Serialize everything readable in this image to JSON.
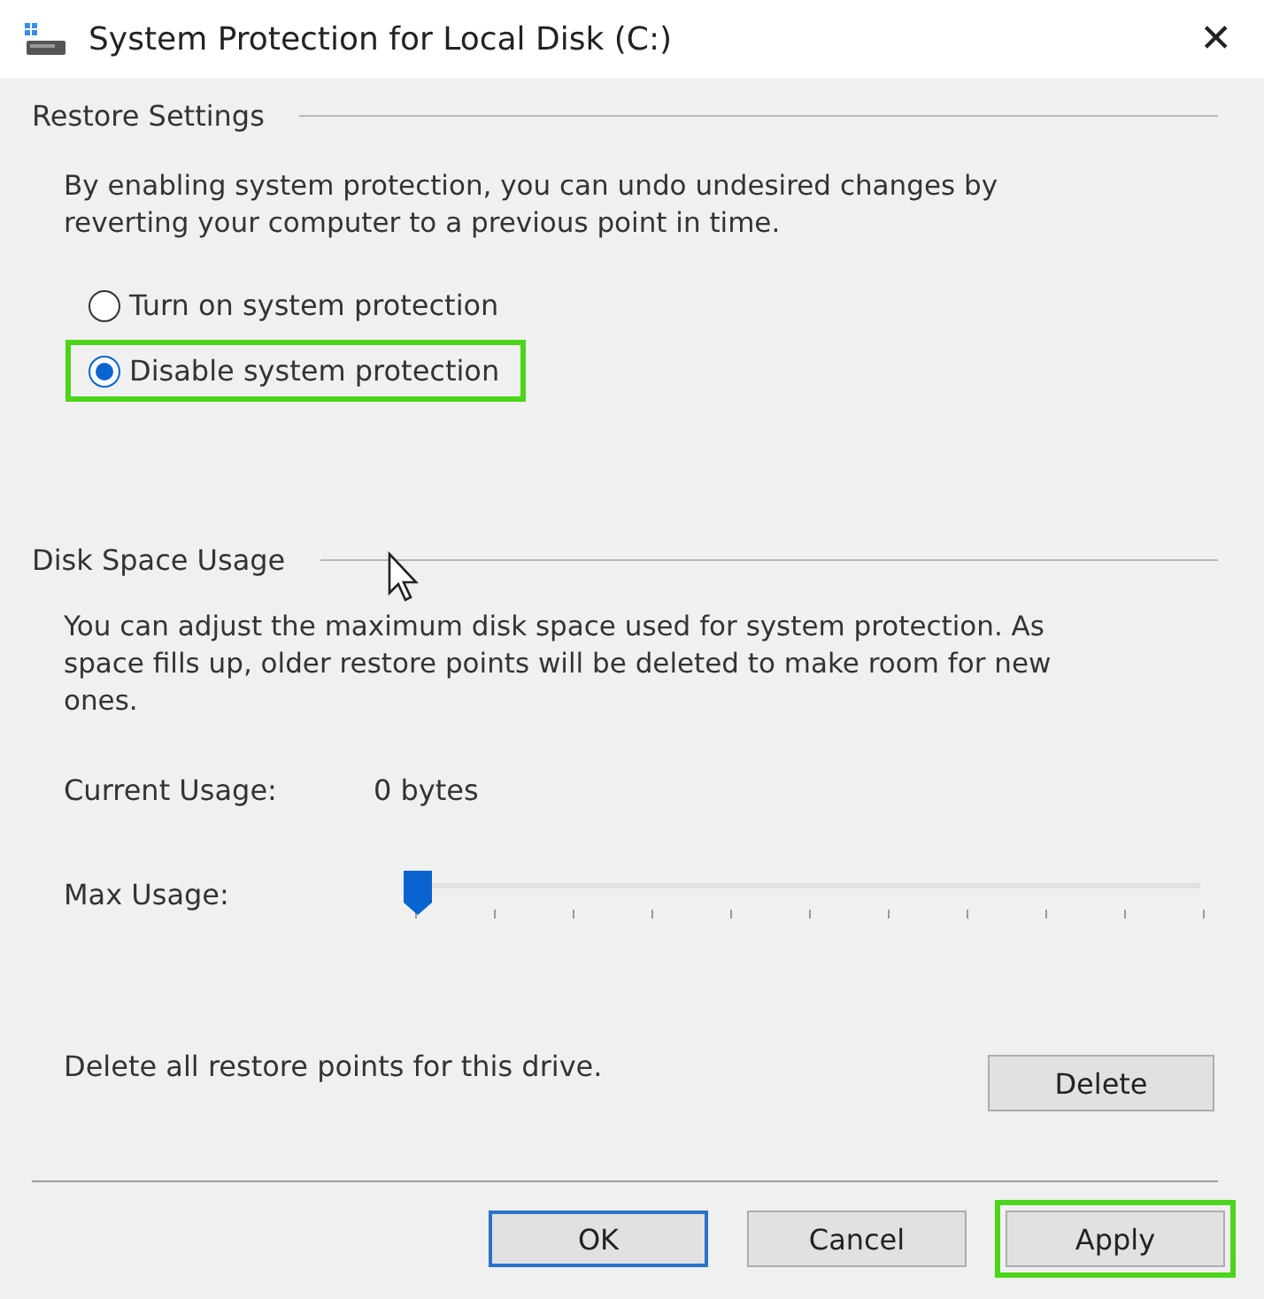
{
  "window": {
    "title": "System Protection for Local Disk (C:)",
    "close": "✕"
  },
  "restore_settings": {
    "heading": "Restore Settings",
    "description": "By enabling system protection, you can undo undesired changes by reverting your computer to a previous point in time.",
    "options": [
      {
        "label": "Turn on system protection",
        "selected": false,
        "highlighted": false
      },
      {
        "label": "Disable system protection",
        "selected": true,
        "highlighted": true
      }
    ]
  },
  "disk_space_usage": {
    "heading": "Disk Space Usage",
    "description": "You can adjust the maximum disk space used for system protection. As space fills up, older restore points will be deleted to make room for new ones.",
    "current_usage_label": "Current Usage:",
    "current_usage_value": "0 bytes",
    "max_usage_label": "Max Usage:",
    "max_usage": {
      "level": 0
    },
    "delete_label": "Delete all restore points for this drive.",
    "delete_button": "Delete"
  },
  "buttons": [
    {
      "label": "OK",
      "default": true,
      "highlighted": false
    },
    {
      "label": "Cancel",
      "default": false,
      "highlighted": false
    },
    {
      "label": "Apply",
      "default": false,
      "highlighted": true
    }
  ]
}
